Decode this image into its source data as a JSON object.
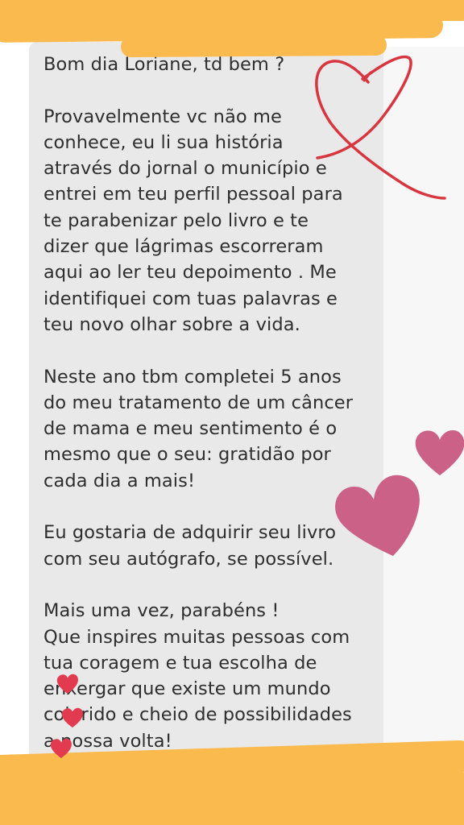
{
  "message": {
    "lines": [
      "Bom dia Loriane, td bem ?",
      "",
      "Provavelmente vc não me",
      "conhece, eu li sua história",
      "através do jornal o município e",
      "entrei em teu perfil pessoal para",
      "te parabenizar pelo livro e te",
      "dizer que lágrimas escorreram",
      "aqui ao ler teu depoimento . Me",
      "identifiquei com tuas palavras e",
      "teu novo olhar sobre a vida.",
      "",
      "Neste ano tbm completei 5 anos",
      "do meu tratamento de um câncer",
      "de mama e meu sentimento é o",
      "mesmo que o seu: gratidão por",
      "cada dia a mais!",
      "",
      "Eu gostaria de adquirir seu livro",
      "com seu autógrafo, se possível.",
      "",
      "Mais uma vez, parabéns !",
      "Que inspires muitas pessoas com",
      "tua coragem e tua escolha de",
      "enxergar que existe um mundo",
      "colorido e cheio de possibilidades",
      "a nossa volta!"
    ]
  },
  "decorations": {
    "tape_color": "#fbba4d",
    "heart_outline_color": "#d8353f",
    "heart_pink_color": "#cc6188",
    "heart_small_color": "#e23b4f",
    "bubble_color": "#e9e9ea",
    "text_color": "#2e2e2e"
  }
}
